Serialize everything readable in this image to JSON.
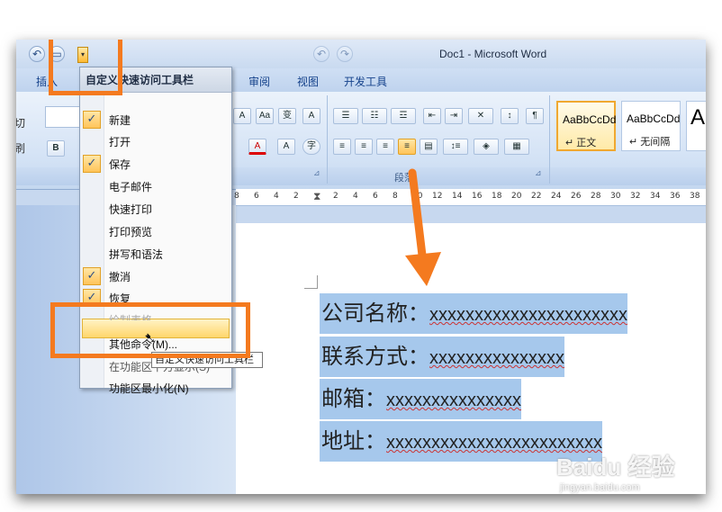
{
  "window": {
    "title": "Doc1 - Microsoft Word"
  },
  "tabs": [
    "插入",
    "审阅",
    "视图",
    "开发工具"
  ],
  "ribbon": {
    "left_stub": [
      "切",
      "刷"
    ],
    "font_buttons_row1": [
      "A",
      "Aa",
      "变",
      "A"
    ],
    "font_buttons_row2": [
      "B",
      "A",
      "A",
      "字"
    ],
    "paragraph_group_label": "段落",
    "styles": [
      {
        "preview": "AaBbCcDd",
        "name": "↵ 正文"
      },
      {
        "preview": "AaBbCcDd",
        "name": "↵ 无间隔"
      },
      {
        "preview": "A",
        "name": ""
      }
    ]
  },
  "ruler": {
    "ticks": [
      "8",
      "6",
      "4",
      "2",
      "",
      "2",
      "4",
      "6",
      "8",
      "10",
      "12",
      "14",
      "16",
      "18",
      "20",
      "22",
      "24",
      "26",
      "28",
      "30",
      "32",
      "34",
      "36",
      "38"
    ]
  },
  "document": {
    "lines": [
      {
        "label": "公司名称：",
        "value": "xxxxxxxxxxxxxxxxxxxxxx"
      },
      {
        "label": "联系方式：",
        "value": "xxxxxxxxxxxxxxx"
      },
      {
        "label": "邮箱：",
        "value": "xxxxxxxxxxxxxxx"
      },
      {
        "label": "地址：",
        "value": "xxxxxxxxxxxxxxxxxxxxxxxx"
      }
    ]
  },
  "qat_menu": {
    "title": "自定义快速访问工具栏",
    "items": [
      {
        "label": "新建",
        "checked": true
      },
      {
        "label": "打开",
        "checked": false
      },
      {
        "label": "保存",
        "checked": true
      },
      {
        "label": "电子邮件",
        "checked": false
      },
      {
        "label": "快速打印",
        "checked": false
      },
      {
        "label": "打印预览",
        "checked": false
      },
      {
        "label": "拼写和语法",
        "checked": false
      },
      {
        "label": "撤消",
        "checked": true
      },
      {
        "label": "恢复",
        "checked": true
      },
      {
        "label": "绘制表格",
        "checked": false
      },
      {
        "label": "其他命令(M)...",
        "checked": false,
        "highlighted": true
      },
      {
        "label": "在功能区下方显示(S)",
        "checked": false
      },
      {
        "label": "功能区最小化(N)",
        "checked": false
      }
    ],
    "tooltip": "自定义快速访问工具栏"
  },
  "watermark": {
    "brand": "Baidu 经验",
    "url": "jingyan.baidu.com"
  },
  "colors": {
    "annotation": "#f47a1f",
    "selection": "#a6c8ec",
    "menu_highlight": "#ffd66b"
  }
}
